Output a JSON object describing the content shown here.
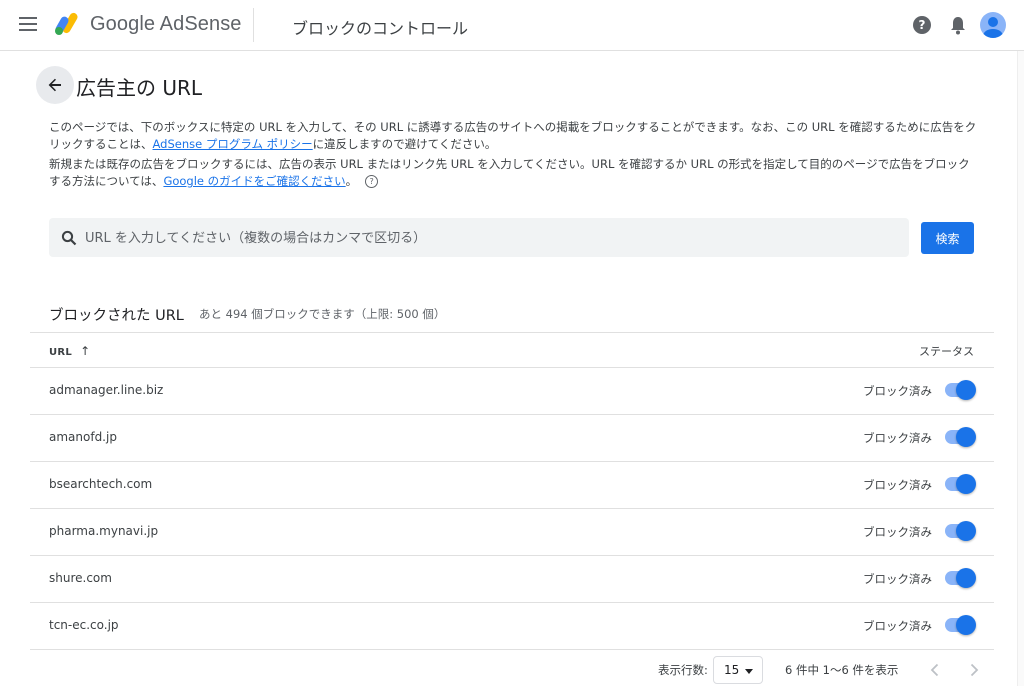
{
  "header": {
    "brand_google": "Google",
    "brand_product": "AdSense",
    "app_title": "ブロックのコントロール",
    "icons": [
      "menu-icon",
      "help-icon",
      "bell-icon",
      "avatar"
    ]
  },
  "page": {
    "title": "広告主の URL",
    "desc1_a": "このページでは、下のボックスに特定の URL を入力して、その URL に誘導する広告のサイトへの掲載をブロックすることができます。なお、この URL を確認するために広告をクリックすることは、",
    "desc1_link": "AdSense プログラム ポリシー",
    "desc1_b": "に違反しますので避けてください。",
    "desc2_a": "新規または既存の広告をブロックするには、広告の表示 URL またはリンク先 URL を入力してください。URL を確認するか URL の形式を指定して目的のページで広告をブロックする方法については、",
    "desc2_link": "Google のガイドをご確認ください",
    "desc2_b": "。"
  },
  "search": {
    "placeholder": "URL を入力してください（複数の場合はカンマで区切る）",
    "value": "",
    "button": "検索"
  },
  "blocked": {
    "title": "ブロックされた URL",
    "subtitle": "あと 494 個ブロックできます（上限: 500 個）",
    "col_url": "URL",
    "col_status": "ステータス",
    "rows": [
      {
        "url": "admanager.line.biz",
        "status": "ブロック済み",
        "on": true
      },
      {
        "url": "amanofd.jp",
        "status": "ブロック済み",
        "on": true
      },
      {
        "url": "bsearchtech.com",
        "status": "ブロック済み",
        "on": true
      },
      {
        "url": "pharma.mynavi.jp",
        "status": "ブロック済み",
        "on": true
      },
      {
        "url": "shure.com",
        "status": "ブロック済み",
        "on": true
      },
      {
        "url": "tcn-ec.co.jp",
        "status": "ブロック済み",
        "on": true
      }
    ]
  },
  "pagination": {
    "rows_label": "表示行数:",
    "rows_value": "15",
    "range": "6 件中 1〜6 件を表示"
  },
  "colors": {
    "accent": "#1a73e8",
    "toggle_track": "#8ab4f8"
  }
}
